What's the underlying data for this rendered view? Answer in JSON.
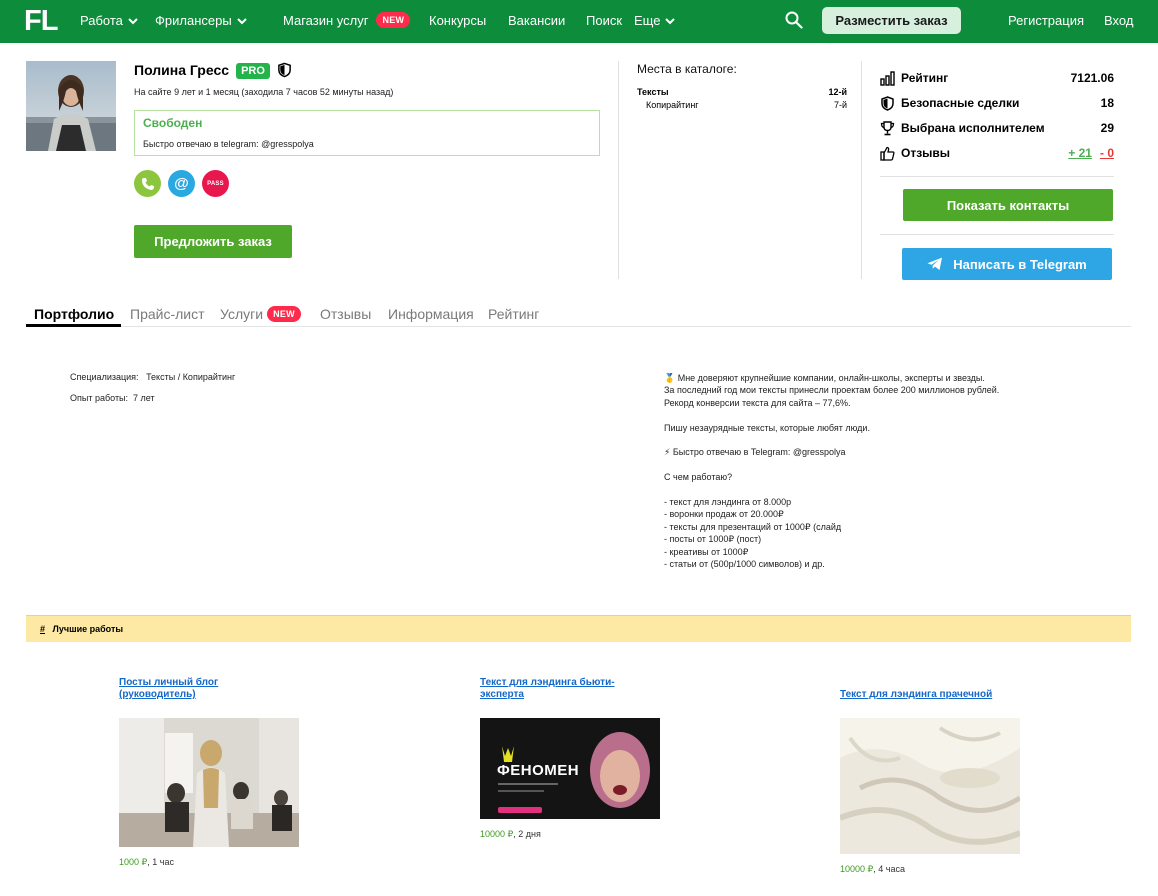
{
  "nav": {
    "logo": "FL",
    "items": {
      "work": "Работа",
      "freelancers": "Фрилансеры",
      "shop": "Магазин услуг",
      "contests": "Конкурсы",
      "vacancies": "Вакансии",
      "search": "Поиск",
      "more": "Еще"
    },
    "new_badge": "NEW",
    "place_order": "Разместить заказ",
    "register": "Регистрация",
    "login": "Вход"
  },
  "profile": {
    "name": "Полина Гресс",
    "pro_badge": "PRO",
    "on_site": "На сайте 9 лет и 1 месяц (заходила 7 часов 52 минуты назад)",
    "status": "Свободен",
    "status_note": "Быстро отвечаю в telegram: @gresspolya",
    "pass_label": "PASS",
    "email_label": "@",
    "offer_button": "Предложить заказ"
  },
  "catalog": {
    "title": "Места в каталоге:",
    "rows": [
      {
        "label": "Тексты",
        "value": "12-й"
      },
      {
        "label": "Копирайтинг",
        "value": "7-й"
      }
    ]
  },
  "stats": {
    "rating_label": "Рейтинг",
    "rating_value": "7121.06",
    "safe_label": "Безопасные сделки",
    "safe_value": "18",
    "chosen_label": "Выбрана исполнителем",
    "chosen_value": "29",
    "reviews_label": "Отзывы",
    "reviews_pos": "+ 21",
    "reviews_neg": "- 0",
    "show_contacts": "Показать контакты",
    "telegram": "Написать в Telegram"
  },
  "tabs": {
    "portfolio": "Портфолио",
    "pricelist": "Прайс-лист",
    "services": "Услуги",
    "reviews": "Отзывы",
    "information": "Информация",
    "rating": "Рейтинг"
  },
  "info": {
    "spec_label": "Специализация:",
    "spec_value": "Тексты / Копирайтинг",
    "exp_label": "Опыт работы:",
    "exp_value": "7 лет",
    "about": "🥇 Мне доверяют крупнейшие компании, онлайн-школы, эксперты и звезды.\nЗа последний год мои тексты принесли проектам более 200 миллионов рублей.\nРекорд конверсии текста для сайта – 77,6%.\n\nПишу незаурядные тексты, которые любят люди.\n\n⚡ Быстро отвечаю в Telegram: @gresspolya\n\nС чем работаю?\n\n- текст для лэндинга от 8.000р\n- воронки продаж от 20.000₽\n- тексты для презентаций от 1000₽ (слайд\n- посты от 1000₽ (пост)\n- креативы от 1000₽\n- статьи от (500р/1000 символов) и др."
  },
  "best_works": {
    "hash": "#",
    "title": "Лучшие работы",
    "items": [
      {
        "title": "Посты личный блог (руководитель)",
        "price": "1000 ₽",
        "duration": ", 1 час"
      },
      {
        "title": "Текст для лэндинга бьюти-эксперта",
        "price": "10000 ₽",
        "duration": ", 2 дня",
        "image_text": "ФЕНОМЕН"
      },
      {
        "title": "Текст для лэндинга прачечной",
        "price": "10000 ₽",
        "duration": ", 4 часа"
      }
    ]
  },
  "colors": {
    "nav_green": "#0d8c3c",
    "button_green": "#4fa82a",
    "telegram_blue": "#2ea6e6",
    "new_red": "#ff2b4a",
    "best_bar": "#fde8a4",
    "link_blue": "#1468c8"
  }
}
